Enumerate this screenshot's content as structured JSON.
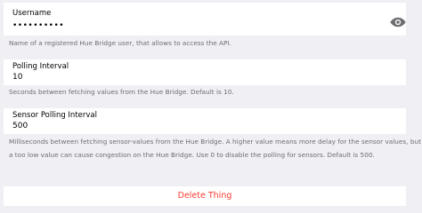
{
  "username": {
    "label": "Username",
    "value": "••••••••••",
    "hint": "Name of a registered Hue Bridge user, that allows to access the API."
  },
  "polling_interval": {
    "label": "Polling Interval",
    "value": "10",
    "hint": "Seconds between fetching values from the Hue Bridge. Default is 10."
  },
  "sensor_polling_interval": {
    "label": "Sensor Polling Interval",
    "value": "500",
    "hint_line1": "Milliseconds between fetching sensor-values from the Hue Bridge. A higher value means more delay for the sensor values, but",
    "hint_line2": "a too low value can cause congestion on the Hue Bridge. Use 0 to disable the polling for sensors. Default is 500."
  },
  "actions": {
    "delete_label": "Delete Thing"
  },
  "icons": {
    "password_toggle": "eye-icon"
  },
  "colors": {
    "danger": "#ff3b30",
    "hint": "#6d6d72",
    "background": "#efeff4"
  }
}
